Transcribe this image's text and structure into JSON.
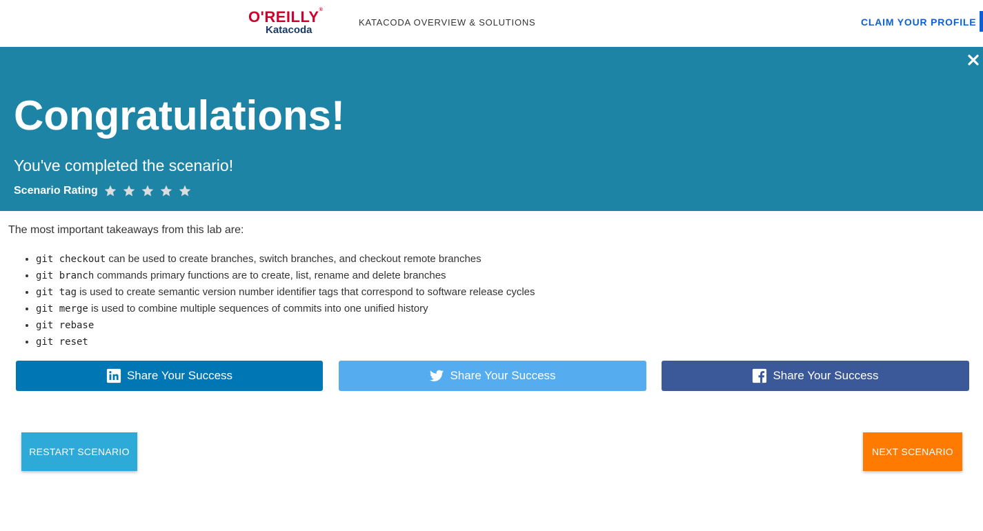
{
  "header": {
    "logo_brand": "O'REILLY",
    "logo_reg": "®",
    "logo_product": "Katacoda",
    "nav_link": "KATACODA OVERVIEW & SOLUTIONS",
    "claim_profile": "CLAIM YOUR PROFILE"
  },
  "banner": {
    "close_icon": "close-icon",
    "title": "Congratulations!",
    "subtitle": "You've completed the scenario!",
    "rating_label": "Scenario Rating",
    "rating_max": 5,
    "background_color": "#1e84a6"
  },
  "content": {
    "intro": "The most important takeaways from this lab are:",
    "takeaways": [
      {
        "code": "git checkout",
        "text": " can be used to create branches, switch branches, and checkout remote branches"
      },
      {
        "code": "git branch",
        "text": " commands primary functions are to create, list, rename and delete branches"
      },
      {
        "code": "git tag",
        "text": " is used to create semantic version number identifier tags that correspond to software release cycles"
      },
      {
        "code": "git merge",
        "text": " is used to combine multiple sequences of commits into one unified history"
      },
      {
        "code": "git rebase",
        "text": ""
      },
      {
        "code": "git reset",
        "text": ""
      }
    ]
  },
  "share": {
    "linkedin_label": "Share Your Success",
    "twitter_label": "Share Your Success",
    "facebook_label": "Share Your Success",
    "linkedin_color": "#0077b5",
    "twitter_color": "#55acee",
    "facebook_color": "#3b5998"
  },
  "actions": {
    "restart_label": "RESTART SCENARIO",
    "next_label": "NEXT SCENARIO",
    "restart_color": "#2eaad9",
    "next_color": "#ff7a00"
  }
}
